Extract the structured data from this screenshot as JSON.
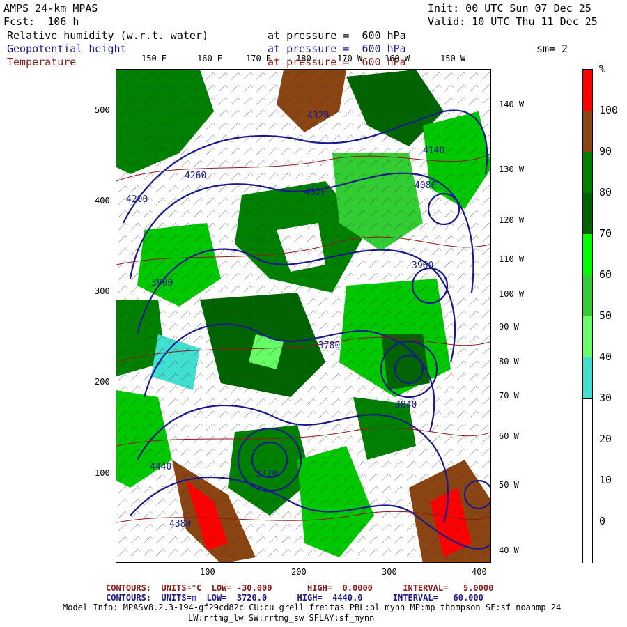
{
  "header": {
    "model": "AMPS 24-km MPAS",
    "forecast": "Fcst:  106 h",
    "init": "Init: 00 UTC Sun 07 Dec 25",
    "valid": "Valid: 10 UTC Thu 11 Dec 25",
    "smoothing": "sm= 2"
  },
  "fields": [
    {
      "name": "Relative humidity (w.r.t. water)",
      "level": "at pressure =  600 hPa",
      "color": "#000000"
    },
    {
      "name": "Geopotential height",
      "level": "at pressure =  600 hPa",
      "color": "#1a1a8c"
    },
    {
      "name": "Temperature",
      "level": "at pressure =  600 hPa",
      "color": "#8b1a1a"
    }
  ],
  "axes": {
    "x_ticks": [
      "100",
      "200",
      "300",
      "400"
    ],
    "y_ticks": [
      "500",
      "400",
      "300",
      "200",
      "100"
    ],
    "top_lon_labels": [
      "150 E",
      "160 E",
      "170 E",
      "180",
      "170 W",
      "160 W",
      "150 W"
    ],
    "right_lon_labels": [
      "140 W",
      "130 W",
      "120 W",
      "110 W",
      "100 W",
      "90 W",
      "80 W",
      "70 W",
      "60 W",
      "50 W",
      "40 W"
    ]
  },
  "colorbar": {
    "unit": "%",
    "labels": [
      "100",
      "90",
      "80",
      "70",
      "60",
      "50",
      "40",
      "30",
      "20",
      "10",
      "0"
    ],
    "colors": [
      "#ff0000",
      "#8b4513",
      "#008000",
      "#006400",
      "#00ff00",
      "#32cd32",
      "#66ff66",
      "#40e0d0",
      "#ffffff",
      "#ffffff",
      "#ffffff",
      "#ffffff"
    ]
  },
  "map_labels": [
    "4260",
    "4200",
    "4320",
    "4140",
    "4080",
    "4020",
    "3960",
    "3900",
    "3840",
    "3780",
    "3720",
    "4440",
    "4380"
  ],
  "footer": {
    "temp_contours": "CONTOURS:  UNITS=°C  LOW= -30.000       HIGH=  0.0000      INTERVAL=   5.0000",
    "height_contours": "CONTOURS:  UNITS=m  LOW=  3720.0      HIGH=  4440.0      INTERVAL=   60.000",
    "model_info": "Model Info: MPASv8.2.3-194-gf29cd82c CU:cu_grell_freitas PBL:bl_mynn MP:mp_thompson SF:sf_noahmp 24",
    "model_info2": "LW:rrtmg_lw SW:rrtmg_sw SFLAY:sf_mynn"
  }
}
